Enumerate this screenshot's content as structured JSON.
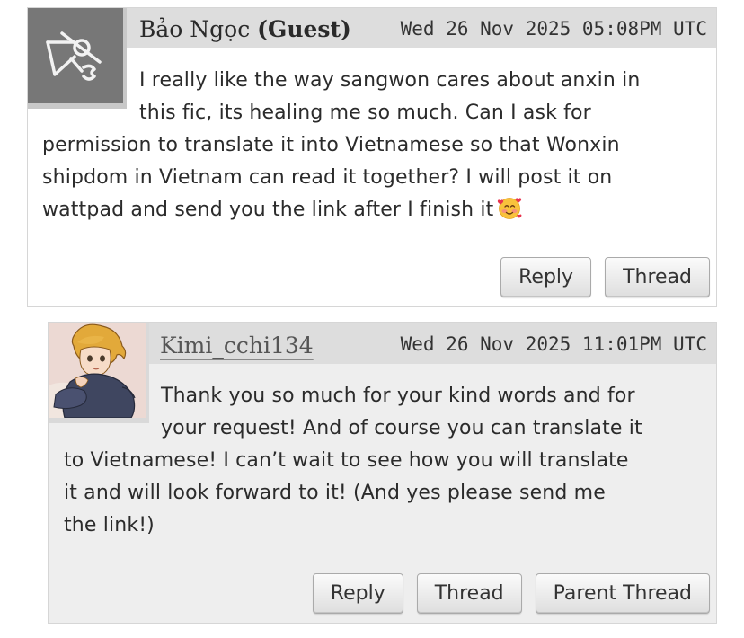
{
  "comments": [
    {
      "author_name": "Bảo Ngọc",
      "author_tag": "(Guest)",
      "datetime": "Wed 26 Nov 2025 05:08PM UTC",
      "avatar_icon": "guest-default-avatar-icon",
      "body_lines": [
        "I really like the way sangwon cares about anxin in",
        "this fic, its healing me so much. Can I ask for",
        "permission to translate it into Vietnamese so that Wonxin",
        "shipdom in Vietnam can read it together? I will post it on",
        "wattpad and send you the link after I finish it"
      ],
      "emoji_icon": "smiling-face-with-hearts-icon",
      "actions": [
        "Reply",
        "Thread"
      ]
    },
    {
      "author_name": "Kimi_cchi134",
      "datetime": "Wed 26 Nov 2025 11:01PM UTC",
      "avatar_icon": "anime-character-avatar-icon",
      "body_lines": [
        "Thank you so much for your kind words and for",
        "your request! And of course you can translate it",
        "to Vietnamese! I can’t wait to see how you will translate",
        "it and will look forward to it! (And yes please send me",
        "the link!)"
      ],
      "actions": [
        "Reply",
        "Thread",
        "Parent Thread"
      ]
    }
  ],
  "colors": {
    "header_bg": "#dddddd",
    "reply_bg": "#eeeeee",
    "guest_avatar_bg": "#777777"
  }
}
